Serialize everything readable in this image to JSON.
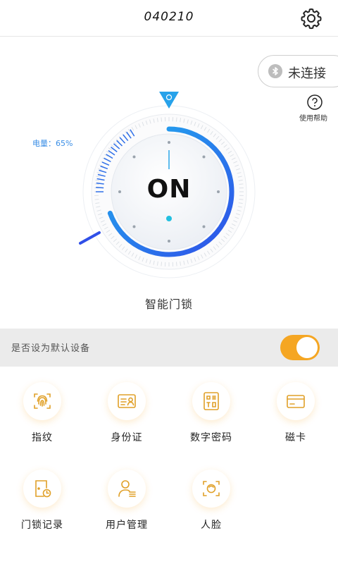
{
  "header": {
    "title": "040210"
  },
  "bluetooth": {
    "status_label": "未连接"
  },
  "help": {
    "label": "使用帮助"
  },
  "dial": {
    "battery_label": "电量：65%",
    "battery_level": 0.65,
    "state_label": "ON"
  },
  "device": {
    "name": "智能门锁"
  },
  "default_setting": {
    "label": "是否设为默认设备",
    "enabled": true
  },
  "functions": [
    {
      "label": "指纹",
      "icon": "fingerprint-icon"
    },
    {
      "label": "身份证",
      "icon": "id-card-icon"
    },
    {
      "label": "数字密码",
      "icon": "keypad-icon"
    },
    {
      "label": "磁卡",
      "icon": "card-icon"
    },
    {
      "label": "门锁记录",
      "icon": "door-record-icon"
    },
    {
      "label": "用户管理",
      "icon": "user-manage-icon"
    },
    {
      "label": "人脸",
      "icon": "face-icon"
    }
  ],
  "colors": {
    "accent": "#f5a623",
    "dial_blue": "#2f6fe8",
    "dial_cyan": "#22b0ef",
    "icon_gold": "#e0a028"
  }
}
